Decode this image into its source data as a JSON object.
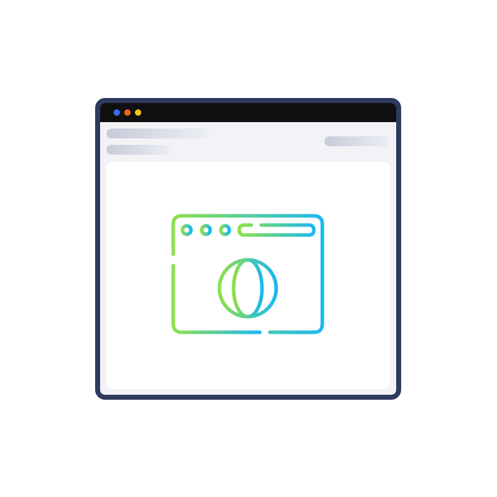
{
  "window": {
    "frame_color": "#2f3a60",
    "titlebar_color": "#101010",
    "body_color": "#f3f3f7",
    "traffic_lights": [
      {
        "icon": "blue-dot-icon",
        "color": "#3d6cf3"
      },
      {
        "icon": "orange-dot-icon",
        "color": "#f0631c"
      },
      {
        "icon": "yellow-dot-icon",
        "color": "#f5c518"
      }
    ]
  },
  "placeholders": {
    "gradient_from": "#c7ccda",
    "gradient_to": "#eceef3"
  },
  "content": {
    "icon": "browser-globe-icon",
    "gradient_start": "#8ee04a",
    "gradient_end": "#1ab8f0"
  }
}
